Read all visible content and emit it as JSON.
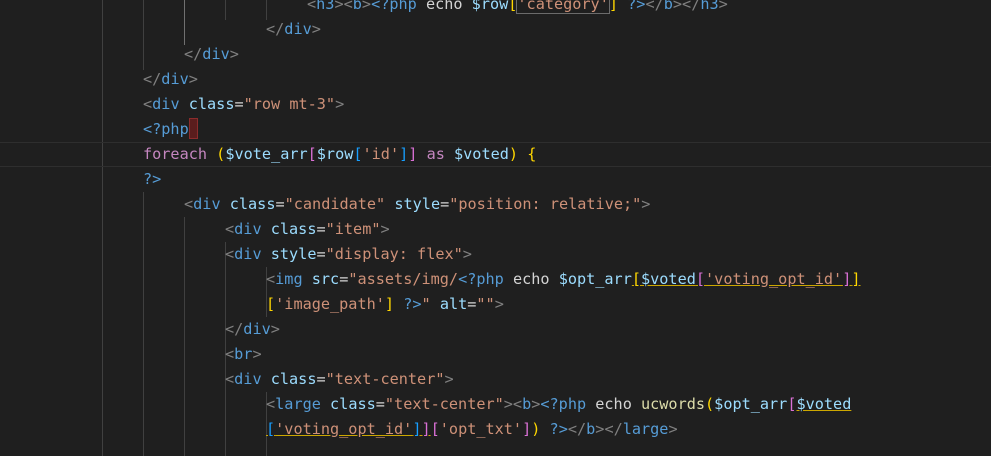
{
  "editor": {
    "language": "php",
    "colors": {
      "background": "#1f1f1f",
      "tag": "#569cd6",
      "attribute": "#9cdcfe",
      "string": "#ce9178",
      "keyword": "#c586c0",
      "function": "#dcdcaa",
      "bracket_level_1": "#ffd700",
      "bracket_level_2": "#da70d6",
      "bracket_level_3": "#179fff"
    },
    "lines": [
      "<h3><b><?php echo $row['category'] ?></b></h3>",
      "</div>",
      "</div>",
      "</div>",
      "<div class=\"row mt-3\">",
      "<?php",
      "foreach ($vote_arr[$row['id']] as $voted) {",
      "?>",
      "<div class=\"candidate\" style=\"position: relative;\">",
      "<div class=\"item\">",
      "<div style=\"display: flex\">",
      "<img src=\"assets/img/<?php echo $opt_arr[$voted['voting_opt_id']]",
      "['image_path'] ?>\" alt=\"\">",
      "</div>",
      "<br>",
      "<div class=\"text-center\">",
      "<large class=\"text-center\"><b><?php echo ucwords($opt_arr[$voted",
      "['voting_opt_id']]['opt_txt']) ?></b></large>"
    ]
  }
}
